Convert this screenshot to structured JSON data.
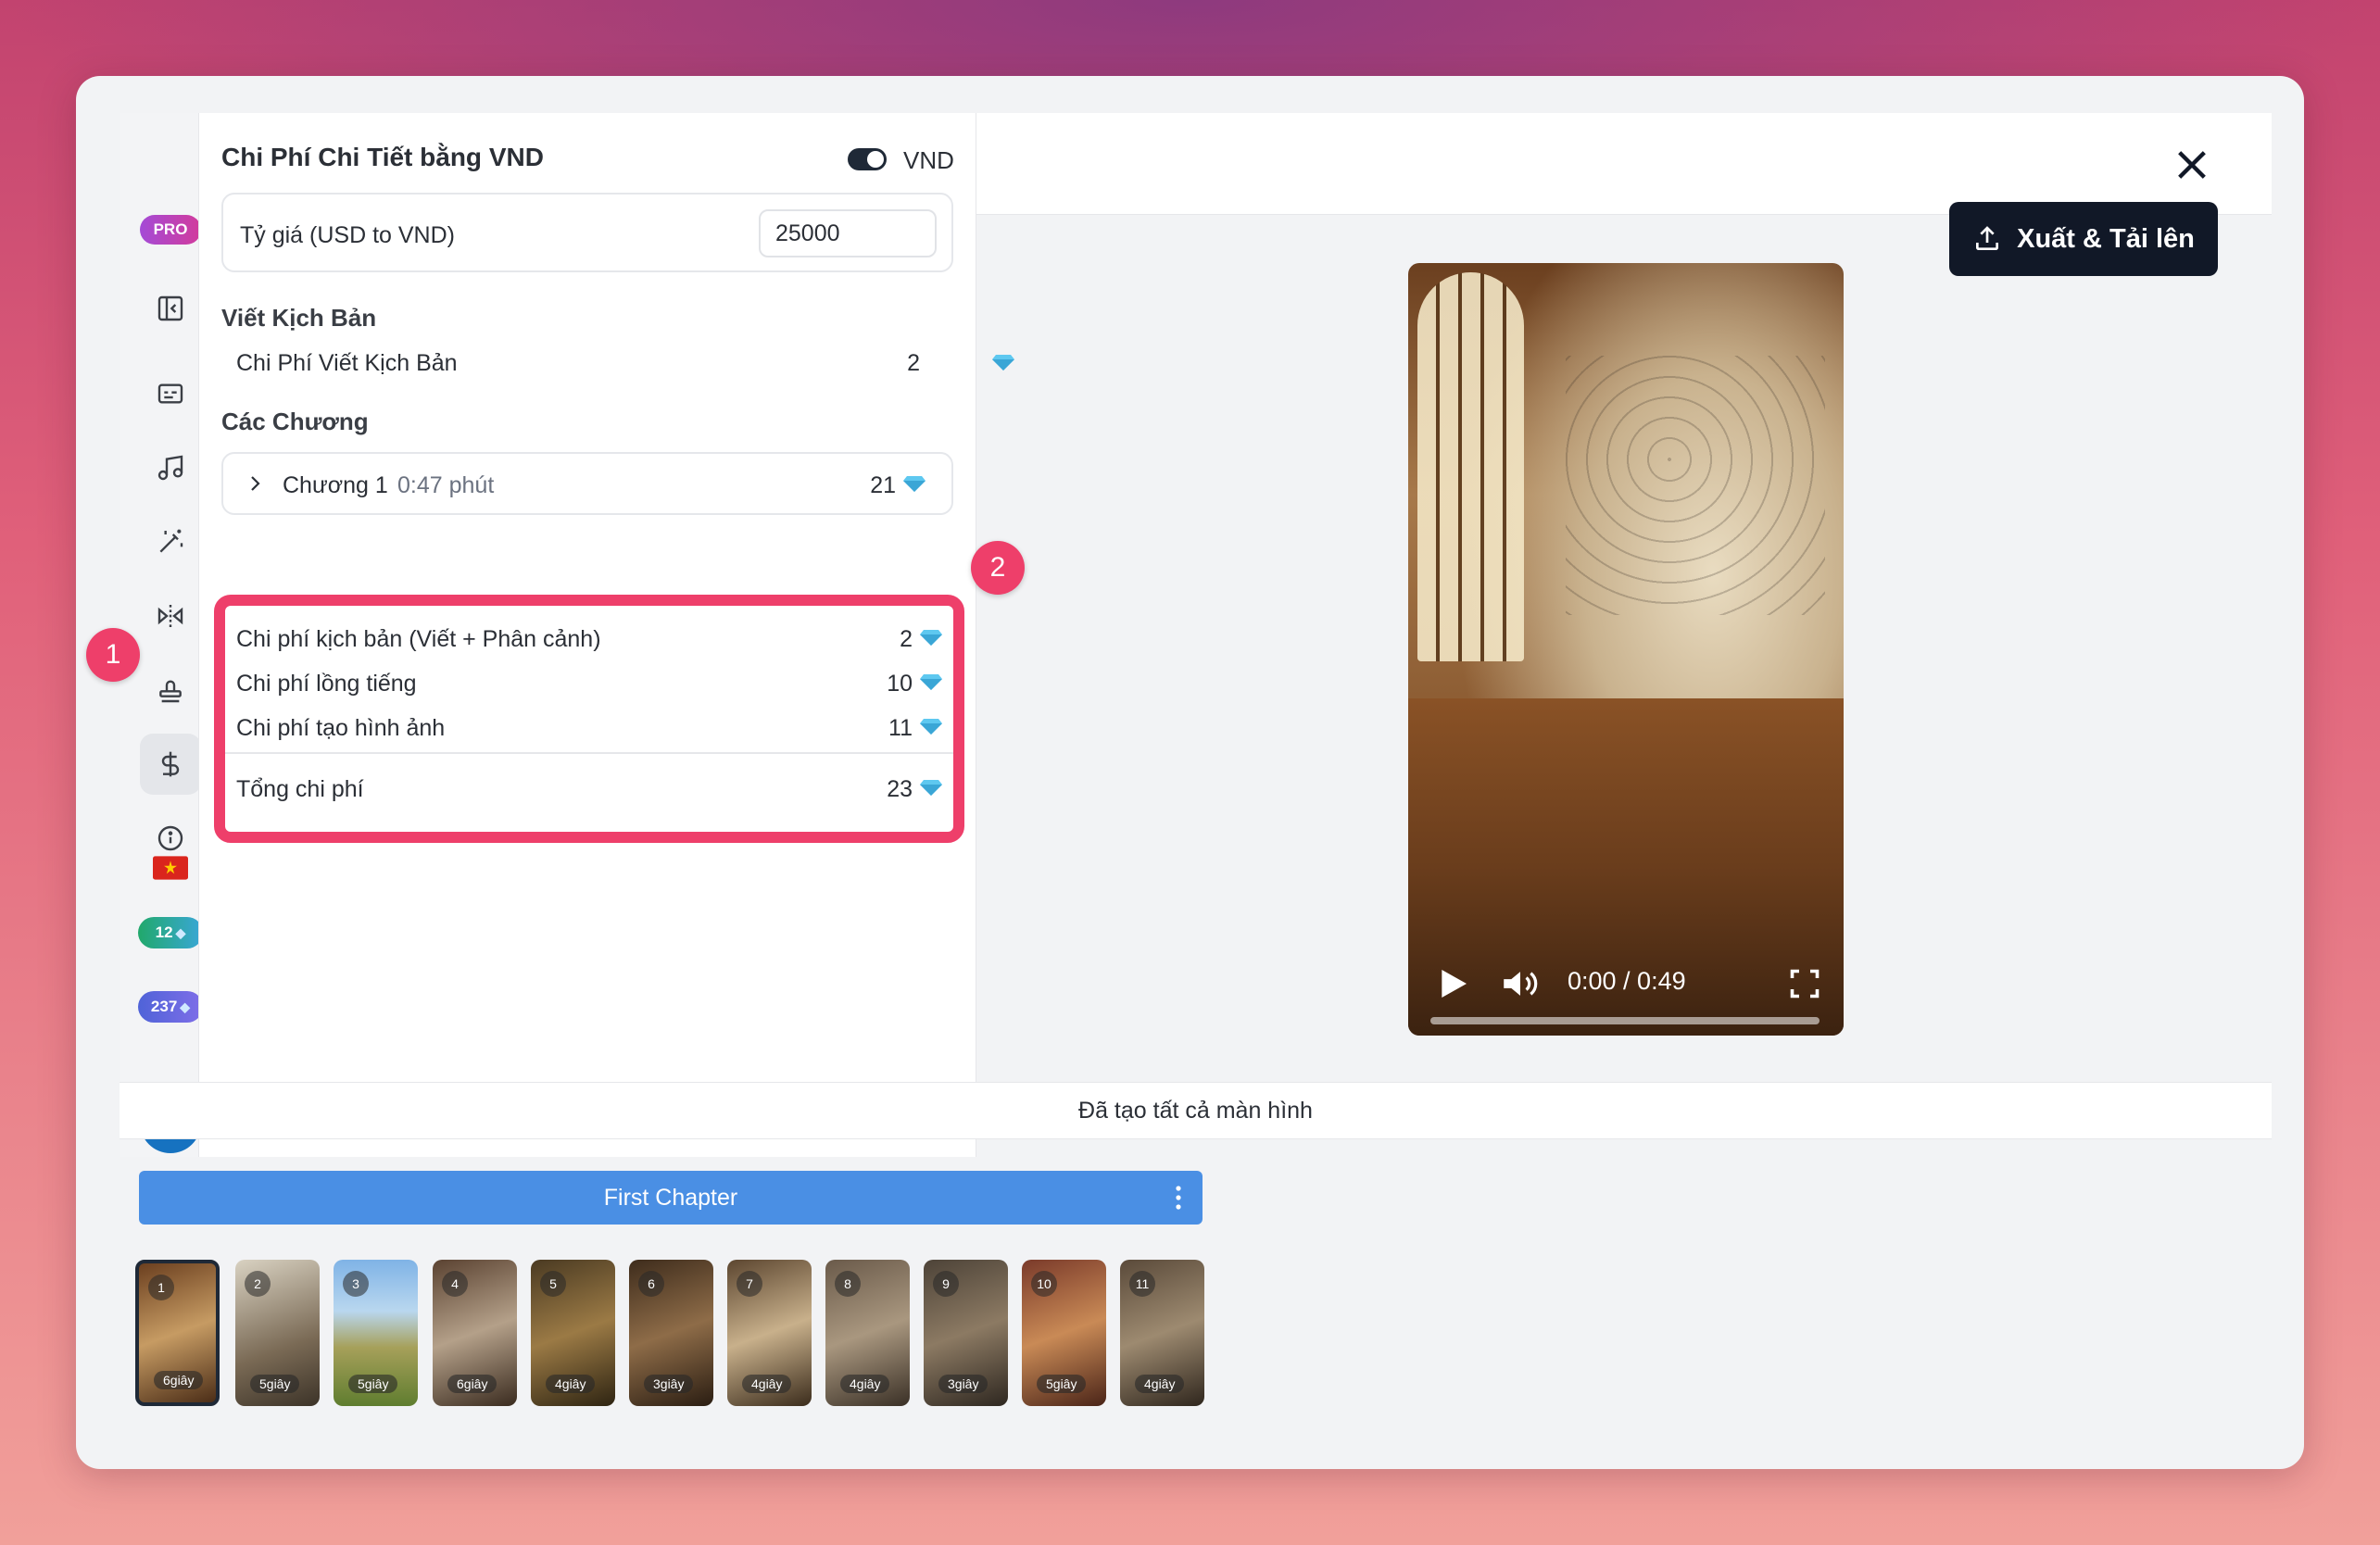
{
  "sidebar": {
    "pro_badge": "PRO",
    "credits_small": "12",
    "credits_large": "237",
    "items": [
      {
        "name": "collapse-panel",
        "icon": "sidebar-collapse-icon"
      },
      {
        "name": "subtitles",
        "icon": "caption-icon"
      },
      {
        "name": "music",
        "icon": "music-note-icon"
      },
      {
        "name": "effects",
        "icon": "magic-wand-icon"
      },
      {
        "name": "flip",
        "icon": "flip-icon"
      },
      {
        "name": "stamp",
        "icon": "stamp-icon"
      },
      {
        "name": "cost",
        "icon": "dollar-icon"
      },
      {
        "name": "info",
        "icon": "info-icon"
      }
    ],
    "language_flag": "vietnam-flag-icon"
  },
  "panel": {
    "title": "Chi Phí Chi Tiết bằng VND",
    "currency_toggle_label": "VND",
    "rate_label": "Tỷ giá (USD to VND)",
    "rate_value": "25000",
    "script_section": "Viết Kịch Bản",
    "script_cost_label": "Chi Phí Viết Kịch Bản",
    "script_cost_value": "2",
    "chapters_section": "Các Chương",
    "chapter": {
      "name": "Chương 1",
      "duration": "0:47 phút",
      "cost": "21"
    },
    "costs": [
      {
        "label": "Chi phí kịch bản (Viết + Phân cảnh)",
        "value": "2"
      },
      {
        "label": "Chi phí lồng tiếng",
        "value": "10"
      },
      {
        "label": "Chi phí tạo hình ảnh",
        "value": "11"
      }
    ],
    "total_label": "Tổng chi phí",
    "total_value": "23"
  },
  "markers": {
    "one": "1",
    "two": "2"
  },
  "header": {
    "export_label": "Xuất & Tải lên"
  },
  "video": {
    "time": "0:00 / 0:49"
  },
  "status": "Đã tạo tất cả màn hình",
  "timeline": {
    "chapter_title": "First Chapter",
    "scenes": [
      {
        "num": "1",
        "dur": "6giây"
      },
      {
        "num": "2",
        "dur": "5giây"
      },
      {
        "num": "3",
        "dur": "5giây"
      },
      {
        "num": "4",
        "dur": "6giây"
      },
      {
        "num": "5",
        "dur": "4giây"
      },
      {
        "num": "6",
        "dur": "3giây"
      },
      {
        "num": "7",
        "dur": "4giây"
      },
      {
        "num": "8",
        "dur": "4giây"
      },
      {
        "num": "9",
        "dur": "3giây"
      },
      {
        "num": "10",
        "dur": "5giây"
      },
      {
        "num": "11",
        "dur": "4giây"
      }
    ]
  },
  "colors": {
    "accent_red": "#ee3f6a",
    "primary_dark": "#111827",
    "chapter_blue": "#4a8fe4",
    "gem_blue": "#5ec8f0"
  }
}
